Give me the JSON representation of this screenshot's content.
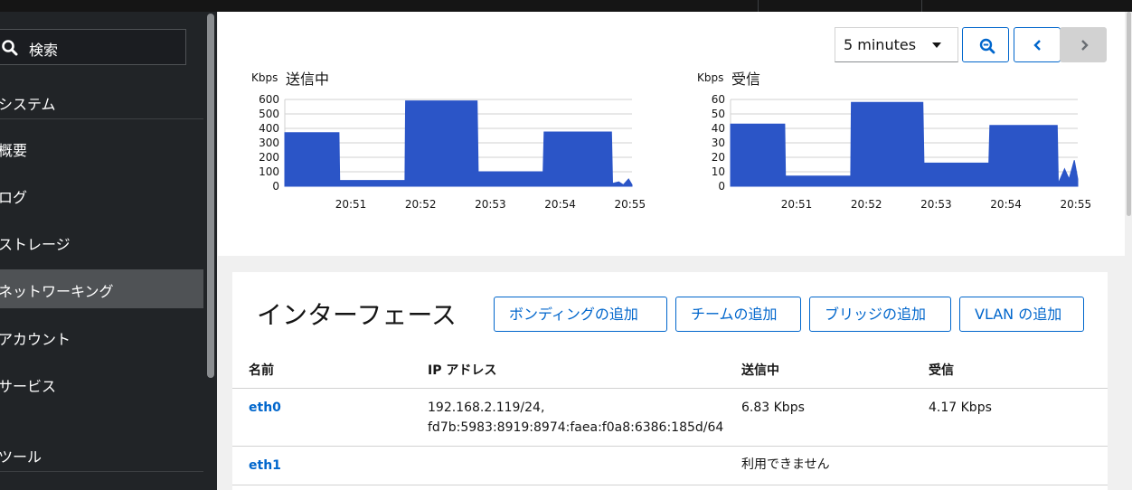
{
  "sidebar": {
    "search_label": "検索",
    "items": [
      {
        "label": "システム"
      },
      {
        "label": "概要"
      },
      {
        "label": "ログ"
      },
      {
        "label": "ストレージ"
      },
      {
        "label": "ネットワーキング",
        "active": true
      },
      {
        "label": "アカウント"
      },
      {
        "label": "サービス"
      },
      {
        "label": "ツール"
      }
    ]
  },
  "toolbar": {
    "range_select": "5 minutes",
    "zoom_icon": "zoom-out-icon",
    "prev_icon": "chevron-left-icon",
    "next_icon": "chevron-right-icon"
  },
  "charts": {
    "sending": {
      "title": "送信中",
      "unit": "Kbps"
    },
    "receiving": {
      "title": "受信",
      "unit": "Kbps"
    }
  },
  "chart_data": [
    {
      "type": "area",
      "title": "送信中",
      "ylabel": "Kbps",
      "ylim": [
        0,
        600
      ],
      "yticks": [
        "0",
        "100",
        "200",
        "300",
        "400",
        "500",
        "600"
      ],
      "xticks": [
        "20:51",
        "20:52",
        "20:53",
        "20:54",
        "20:55"
      ],
      "color": "#2b55c7",
      "series": [
        {
          "values": [
            370,
            370,
            40,
            40,
            590,
            590,
            100,
            100,
            375,
            375,
            20,
            30,
            10,
            50,
            10
          ]
        }
      ]
    },
    {
      "type": "area",
      "title": "受信",
      "ylabel": "Kbps",
      "ylim": [
        0,
        60
      ],
      "yticks": [
        "0",
        "10",
        "20",
        "30",
        "40",
        "50",
        "60"
      ],
      "xticks": [
        "20:51",
        "20:52",
        "20:53",
        "20:54",
        "20:55"
      ],
      "color": "#2b55c7",
      "series": [
        {
          "values": [
            43,
            43,
            7,
            7,
            58,
            58,
            16,
            16,
            42,
            42,
            2,
            12,
            5,
            18,
            5
          ]
        }
      ]
    }
  ],
  "interfaces": {
    "title": "インターフェース",
    "buttons": {
      "add_bond": "ボンディングの追加",
      "add_team": "チームの追加",
      "add_bridge": "ブリッジの追加",
      "add_vlan": "VLAN の追加"
    },
    "columns": {
      "name": "名前",
      "ip": "IP アドレス",
      "sending": "送信中",
      "receiving": "受信"
    },
    "rows": [
      {
        "name": "eth0",
        "ip_line1": "192.168.2.119/24,",
        "ip_line2": "fd7b:5983:8919:8974:faea:f0a8:6386:185d/64",
        "sending": "6.83 Kbps",
        "receiving": "4.17 Kbps"
      },
      {
        "name": "eth1",
        "status": "利用できません"
      }
    ]
  }
}
